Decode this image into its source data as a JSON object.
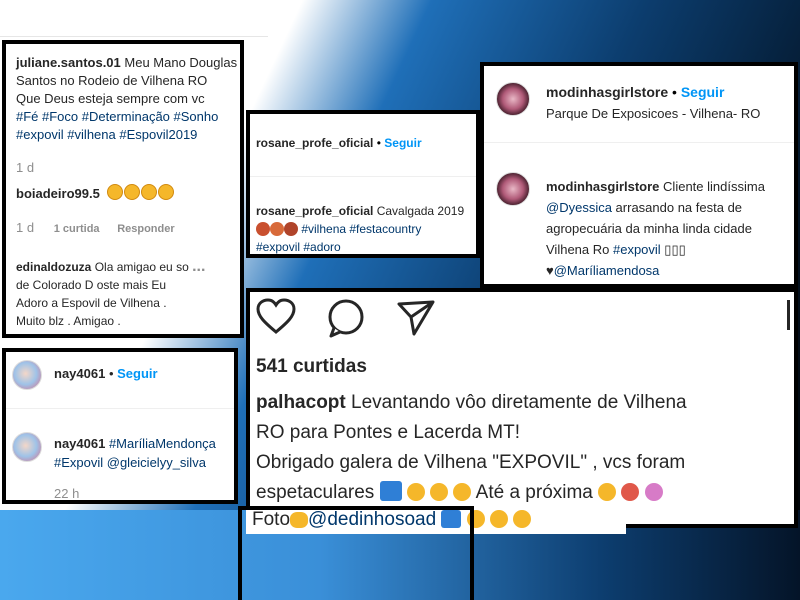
{
  "top_strip": "",
  "juliane": {
    "user": "juliane.santos.01",
    "text_line1": "Meu Mano Douglas",
    "text_line2": "Santos no Rodeio de Vilhena RO",
    "text_line3": "Que Deus esteja sempre com vc",
    "tags_line1": "#Fé #Foco #Determinação #Sonho",
    "tags_line2": "#expovil #vilhena #Espovil2019",
    "time1": "1 d",
    "reply_user": "boiadeiro99.5",
    "time2": "1 d",
    "likes": "1 curtida",
    "reply_label": "Responder",
    "user2": "edinaldozuza",
    "c2_line1": "Ola amigao eu so",
    "c2_line2": "de Colorado D oste mais Eu",
    "c2_line3": "Adoro a Espovil de Vilhena .",
    "c2_line4": "Muito blz . Amigao .",
    "more": "..."
  },
  "nay": {
    "user": "nay4061",
    "follow": "Seguir",
    "c_user": "nay4061",
    "c_tags1": "#MaríliaMendonça",
    "c_tags2": "#Expovil @gleicielyy_silva",
    "time": "22 h"
  },
  "rosane": {
    "user": "rosane_profe_oficial",
    "follow": "Seguir",
    "c_user": "rosane_profe_oficial",
    "c_text": "Cavalgada 2019",
    "c_tags1": "#vilhena #festacountry",
    "c_tags2": "#expovil #adoro"
  },
  "modinhas": {
    "user": "modinhasgirlstore",
    "follow": "Seguir",
    "location": "Parque De Exposicoes - Vilhena- RO",
    "c_user": "modinhasgirlstore",
    "c_text1": "Cliente lindíssima",
    "c_mention": "@Dyessica",
    "c_text2": " arrasando na festa de",
    "c_text3": "agropecuária da minha linda cidade",
    "c_text4": "Vilhena Ro ",
    "c_tag": "#expovil",
    "c_boxes": " ▯▯▯",
    "c_heart": "♥",
    "c_mention2": "@Maríliamendosa"
  },
  "post": {
    "likes": "541 curtidas",
    "user": "palhacopt",
    "line1": "Levantando vôo diretamente de Vilhena",
    "line2": "RO para Pontes e Lacerda MT!",
    "line3": "Obrigado galera de Vilhena \"EXPOVIL\" ,  vcs foram",
    "line4": "espetaculares",
    "line4b": "Até a próxima",
    "line5": "Foto",
    "mention": "@dedinhosoad"
  }
}
